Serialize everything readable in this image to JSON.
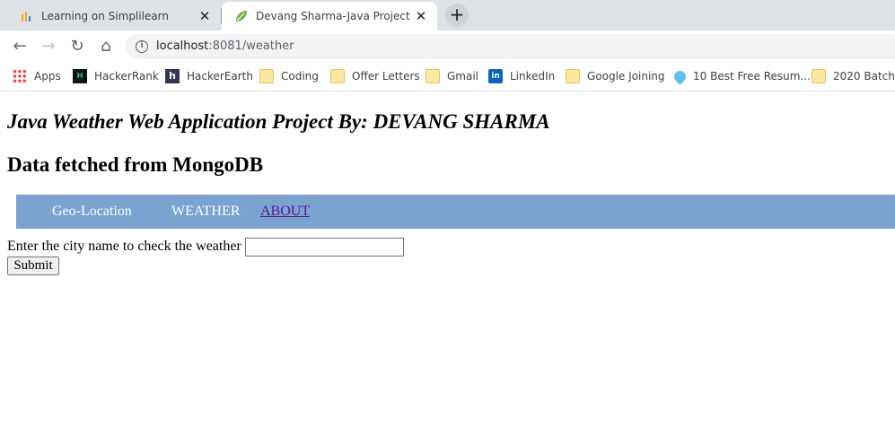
{
  "browser": {
    "tabs": [
      {
        "title": "Learning on Simplilearn",
        "active": false,
        "icon": "simplilearn-icon"
      },
      {
        "title": "Devang Sharma-Java Project",
        "active": true,
        "icon": "spring-leaf-icon"
      }
    ],
    "new_tab_label": "+",
    "close_glyph": "✕",
    "nav": {
      "back": "←",
      "forward": "→",
      "reload": "↻",
      "home": "⌂"
    },
    "url": {
      "host": "localhost",
      "path": ":8081/weather"
    },
    "info_glyph": "i",
    "bookmarks": [
      {
        "label": "Apps",
        "icon": "apps-grid-icon"
      },
      {
        "label": "HackerRank",
        "icon": "hackerrank-icon"
      },
      {
        "label": "HackerEarth",
        "icon": "hackerearth-icon"
      },
      {
        "label": "Coding",
        "icon": "folder-icon"
      },
      {
        "label": "Offer Letters",
        "icon": "folder-icon"
      },
      {
        "label": "Gmail",
        "icon": "folder-icon"
      },
      {
        "label": "LinkedIn",
        "icon": "linkedin-icon"
      },
      {
        "label": "Google Joining",
        "icon": "folder-icon"
      },
      {
        "label": "10 Best Free Resum...",
        "icon": "map-pin-icon"
      },
      {
        "label": "2020 Batch",
        "icon": "folder-icon"
      }
    ]
  },
  "page": {
    "heading": "Java Weather Web Application Project By: DEVANG SHARMA",
    "subheading": "Data fetched from MongoDB",
    "navbar": {
      "items": [
        "Geo-Location",
        "WEATHER",
        "ABOUT"
      ]
    },
    "form": {
      "label": "Enter the city name to check the weather",
      "input_value": "",
      "submit_label": "Submit"
    }
  },
  "colors": {
    "navbar_bg": "#7ba3d0",
    "link_visited": "#551a8b",
    "tabstrip_bg": "#dee1e6"
  }
}
